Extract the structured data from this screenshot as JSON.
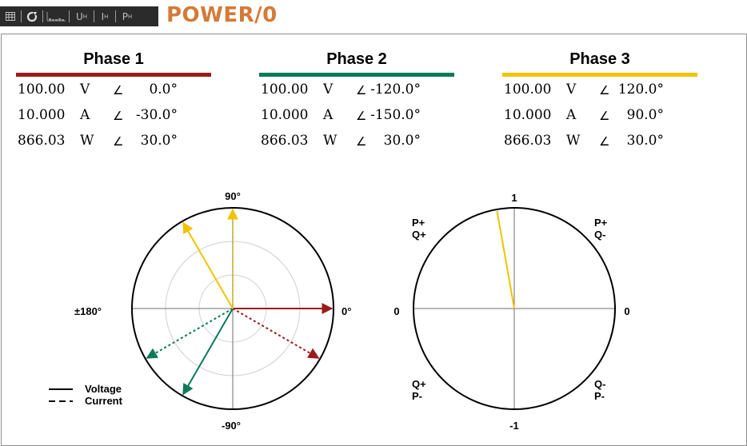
{
  "toolbar": {
    "items": [
      {
        "icon": "table-icon"
      },
      {
        "icon": "refresh-icon"
      },
      {
        "icon": "waveform-icon"
      },
      {
        "label": "U",
        "sub": "H"
      },
      {
        "label": "I",
        "sub": "H"
      },
      {
        "label": "P",
        "sub": "H"
      }
    ]
  },
  "title": "POWER/0",
  "phases": [
    {
      "name": "Phase 1",
      "color": "#9b1c1c",
      "rows": [
        {
          "value": "100.00",
          "unit": "V",
          "angle": "0.0°"
        },
        {
          "value": "10.000",
          "unit": "A",
          "angle": "-30.0°"
        },
        {
          "value": "866.03",
          "unit": "W",
          "angle": "30.0°"
        }
      ]
    },
    {
      "name": "Phase 2",
      "color": "#0a7a5a",
      "rows": [
        {
          "value": "100.00",
          "unit": "V",
          "angle": "-120.0°"
        },
        {
          "value": "10.000",
          "unit": "A",
          "angle": "-150.0°"
        },
        {
          "value": "866.03",
          "unit": "W",
          "angle": "30.0°"
        }
      ]
    },
    {
      "name": "Phase 3",
      "color": "#f2c300",
      "rows": [
        {
          "value": "100.00",
          "unit": "V",
          "angle": "120.0°"
        },
        {
          "value": "10.000",
          "unit": "A",
          "angle": "90.0°"
        },
        {
          "value": "866.03",
          "unit": "W",
          "angle": "30.0°"
        }
      ]
    }
  ],
  "angle_symbol": "∠",
  "phasor_diagram": {
    "label_top": "90°",
    "label_bottom": "-90°",
    "label_left": "±180°",
    "label_right": "0°",
    "legend": {
      "solid": "Voltage",
      "dashed": "Current"
    }
  },
  "pf_diagram": {
    "label_top": "1",
    "label_bottom": "-1",
    "label_left": "0",
    "label_right": "0",
    "q_top_left": [
      "P+",
      "Q+"
    ],
    "q_top_right": [
      "P+",
      "Q-"
    ],
    "q_bottom_left": [
      "Q+",
      "P-"
    ],
    "q_bottom_right": [
      "Q-",
      "P-"
    ],
    "pointer_angle_deg": 100
  }
}
